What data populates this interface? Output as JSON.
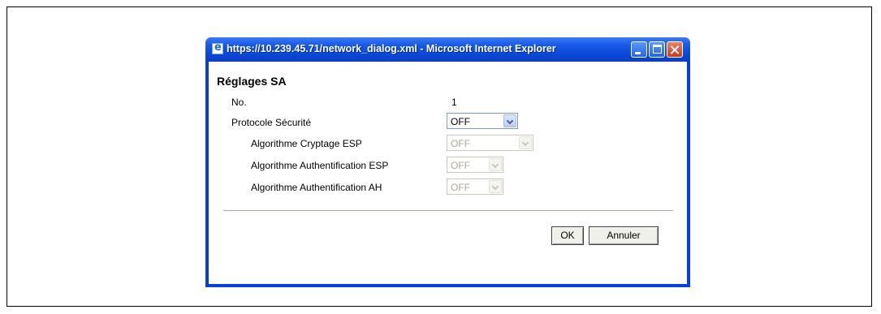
{
  "window": {
    "title": "https://10.239.45.71/network_dialog.xml - Microsoft Internet Explorer"
  },
  "dialog": {
    "heading": "Réglages SA",
    "fields": {
      "no": {
        "label": "No.",
        "value": "1"
      },
      "security_protocol": {
        "label": "Protocole Sécurité",
        "value": "OFF",
        "enabled": true
      },
      "esp_encryption": {
        "label": "Algorithme Cryptage ESP",
        "value": "OFF",
        "enabled": false
      },
      "esp_auth": {
        "label": "Algorithme Authentification ESP",
        "value": "OFF",
        "enabled": false
      },
      "ah_auth": {
        "label": "Algorithme Authentification AH",
        "value": "OFF",
        "enabled": false
      }
    },
    "buttons": {
      "ok": "OK",
      "cancel": "Annuler"
    }
  },
  "colors": {
    "titlebar": "#0a48d8",
    "window_border": "#0a3fd6",
    "close_button": "#c43b1a"
  }
}
